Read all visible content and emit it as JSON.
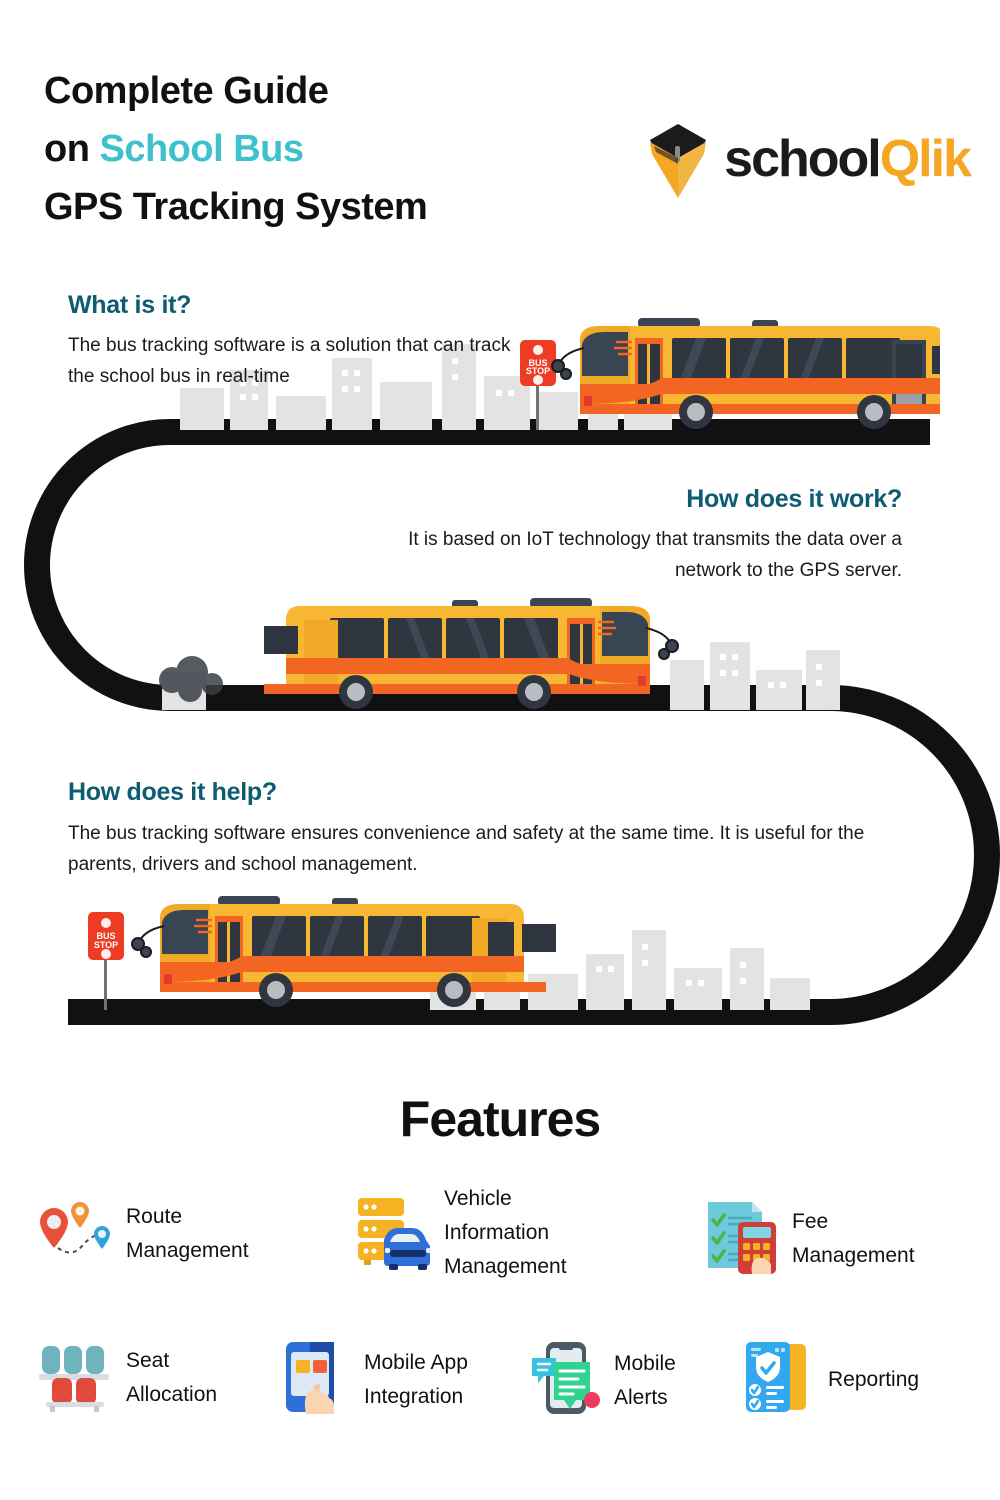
{
  "header": {
    "title_line1": "Complete Guide",
    "title_line2_prefix": "on ",
    "title_line2_accent": "School Bus",
    "title_line3": "GPS Tracking System",
    "accent_color": "#3ec1cd",
    "logo": {
      "text_main": "school",
      "text_accent": "Qlik",
      "mark_name": "graduation-cap-pin-logo",
      "accent_color": "#f5a623"
    }
  },
  "sections": [
    {
      "id": "sec1",
      "heading": "What is it?",
      "body": "The bus tracking software is a solution that can track the school bus in real-time",
      "heading_color": "#0d5c72",
      "align": "left"
    },
    {
      "id": "sec2",
      "heading": "How does it work?",
      "body": "It is based on IoT technology that transmits the data over a network to the GPS server.",
      "heading_color": "#0d5c72",
      "align": "right"
    },
    {
      "id": "sec3",
      "heading": "How does it help?",
      "body": "The bus tracking software ensures convenience and safety at the same time. It is useful for the parents, drivers and school management.",
      "heading_color": "#0d5c72",
      "align": "left"
    }
  ],
  "illustration": {
    "road_color": "#111111",
    "bus_body_color": "#f7b733",
    "bus_stripe_color": "#f26522",
    "bus_window_color": "#394553",
    "skyline_color": "#e3e3e3",
    "bus_stop_sign_label_line1": "BUS",
    "bus_stop_sign_label_line2": "STOP",
    "bus_stop_sign_color": "#ee3b24",
    "buses": [
      {
        "name": "bus-top",
        "facing": "left"
      },
      {
        "name": "bus-middle",
        "facing": "right"
      },
      {
        "name": "bus-bottom",
        "facing": "left"
      }
    ]
  },
  "features_title": "Features",
  "features": [
    {
      "label": "Route\nManagement",
      "icon": "map-pins-route-icon"
    },
    {
      "label": "Vehicle\nInformation\nManagement",
      "icon": "server-car-icon"
    },
    {
      "label": "Fee\nManagement",
      "icon": "checklist-calculator-icon"
    },
    {
      "label": "Seat\nAllocation",
      "icon": "bus-seats-icon"
    },
    {
      "label": "Mobile App\nIntegration",
      "icon": "smartphone-tap-icon"
    },
    {
      "label": "Mobile\nAlerts",
      "icon": "phone-chat-bubble-icon"
    },
    {
      "label": "Reporting",
      "icon": "clipboard-shield-report-icon"
    }
  ]
}
